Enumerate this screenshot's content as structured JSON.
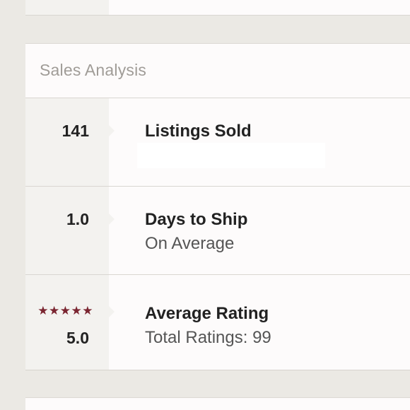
{
  "section": {
    "title": "Sales Analysis"
  },
  "stats": [
    {
      "value": "141",
      "label": "Listings Sold",
      "sub": ""
    },
    {
      "value": "1.0",
      "label": "Days to Ship",
      "sub": "On Average"
    },
    {
      "value": "5.0",
      "label": "Average Rating",
      "sub": "Total Ratings: 99",
      "stars": "★★★★★",
      "star_color": "#7a2530"
    }
  ],
  "colors": {
    "background": "#ebe9e4",
    "card": "#fdfbfb",
    "stat_column": "#f3f2ef",
    "title_text": "#a09c97",
    "primary_text": "#222222",
    "secondary_text": "#555555"
  }
}
